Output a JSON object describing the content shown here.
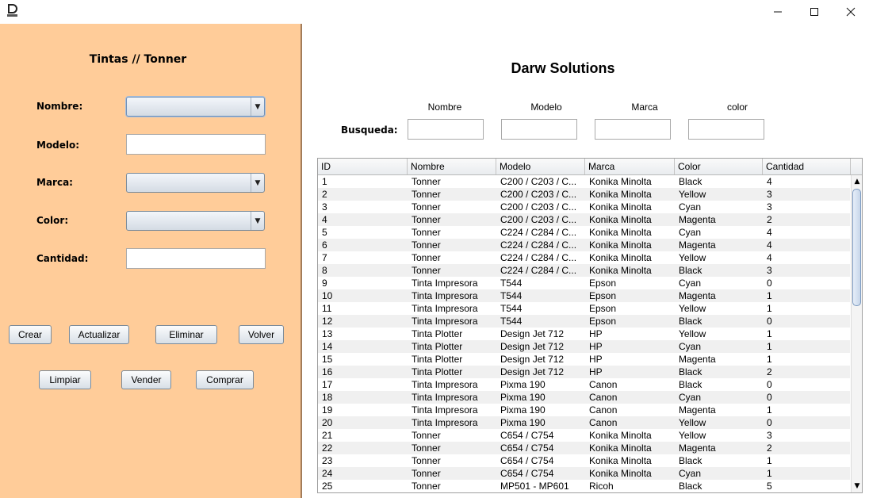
{
  "window": {
    "app_icon": "app-logo-icon"
  },
  "left_panel": {
    "title": "Tintas // Tonner",
    "labels": {
      "nombre": "Nombre:",
      "modelo": "Modelo:",
      "marca": "Marca:",
      "color": "Color:",
      "cantidad": "Cantidad:"
    },
    "values": {
      "nombre": "",
      "modelo": "",
      "marca": "",
      "color": "",
      "cantidad": ""
    },
    "buttons": {
      "crear": "Crear",
      "actualizar": "Actualizar",
      "eliminar": "Eliminar",
      "volver": "Volver",
      "limpiar": "Limpiar",
      "vender": "Vender",
      "comprar": "Comprar"
    }
  },
  "main": {
    "title": "Darw Solutions",
    "search": {
      "label": "Busqueda:",
      "headers": [
        "Nombre",
        "Modelo",
        "Marca",
        "color"
      ],
      "values": [
        "",
        "",
        "",
        ""
      ]
    },
    "table": {
      "columns": [
        "ID",
        "Nombre",
        "Modelo",
        "Marca",
        "Color",
        "Cantidad"
      ],
      "rows": [
        [
          "1",
          "Tonner",
          "C200 / C203 / C...",
          "Konika Minolta",
          "Black",
          "4"
        ],
        [
          "2",
          "Tonner",
          "C200 / C203 / C...",
          "Konika Minolta",
          "Yellow",
          "3"
        ],
        [
          "3",
          "Tonner",
          "C200 / C203 / C...",
          "Konika Minolta",
          "Cyan",
          "3"
        ],
        [
          "4",
          "Tonner",
          "C200 / C203 / C...",
          "Konika Minolta",
          "Magenta",
          "2"
        ],
        [
          "5",
          "Tonner",
          "C224 / C284 / C...",
          "Konika Minolta",
          "Cyan",
          "4"
        ],
        [
          "6",
          "Tonner",
          "C224 / C284 / C...",
          "Konika Minolta",
          "Magenta",
          "4"
        ],
        [
          "7",
          "Tonner",
          "C224 / C284 / C...",
          "Konika Minolta",
          "Yellow",
          "4"
        ],
        [
          "8",
          "Tonner",
          "C224 / C284 / C...",
          "Konika Minolta",
          "Black",
          "3"
        ],
        [
          "9",
          "Tinta Impresora",
          "T544",
          "Epson",
          "Cyan",
          "0"
        ],
        [
          "10",
          "Tinta Impresora",
          "T544",
          "Epson",
          "Magenta",
          "1"
        ],
        [
          "11",
          "Tinta Impresora",
          "T544",
          "Epson",
          "Yellow",
          "1"
        ],
        [
          "12",
          "Tinta Impresora",
          "T544",
          "Epson",
          "Black",
          "0"
        ],
        [
          "13",
          "Tinta Plotter",
          "Design Jet 712",
          "HP",
          "Yellow",
          "1"
        ],
        [
          "14",
          "Tinta Plotter",
          "Design Jet 712",
          "HP",
          "Cyan",
          "1"
        ],
        [
          "15",
          "Tinta Plotter",
          "Design Jet 712",
          "HP",
          "Magenta",
          "1"
        ],
        [
          "16",
          "Tinta Plotter",
          "Design Jet 712",
          "HP",
          "Black",
          "2"
        ],
        [
          "17",
          "Tinta Impresora",
          "Pixma 190",
          "Canon",
          "Black",
          "0"
        ],
        [
          "18",
          "Tinta Impresora",
          "Pixma 190",
          "Canon",
          "Cyan",
          "0"
        ],
        [
          "19",
          "Tinta Impresora",
          "Pixma 190",
          "Canon",
          "Magenta",
          "1"
        ],
        [
          "20",
          "Tinta Impresora",
          "Pixma 190",
          "Canon",
          "Yellow",
          "0"
        ],
        [
          "21",
          "Tonner",
          "C654 / C754",
          "Konika Minolta",
          "Yellow",
          "3"
        ],
        [
          "22",
          "Tonner",
          "C654 / C754",
          "Konika Minolta",
          "Magenta",
          "2"
        ],
        [
          "23",
          "Tonner",
          "C654 / C754",
          "Konika Minolta",
          "Black",
          "1"
        ],
        [
          "24",
          "Tonner",
          "C654 / C754",
          "Konika Minolta",
          "Cyan",
          "1"
        ],
        [
          "25",
          "Tonner",
          "MP501 - MP601",
          "Ricoh",
          "Black",
          "5"
        ]
      ]
    }
  },
  "colors": {
    "left_panel_bg": "#ffcc99",
    "alt_row_bg": "#f0f0f0"
  }
}
